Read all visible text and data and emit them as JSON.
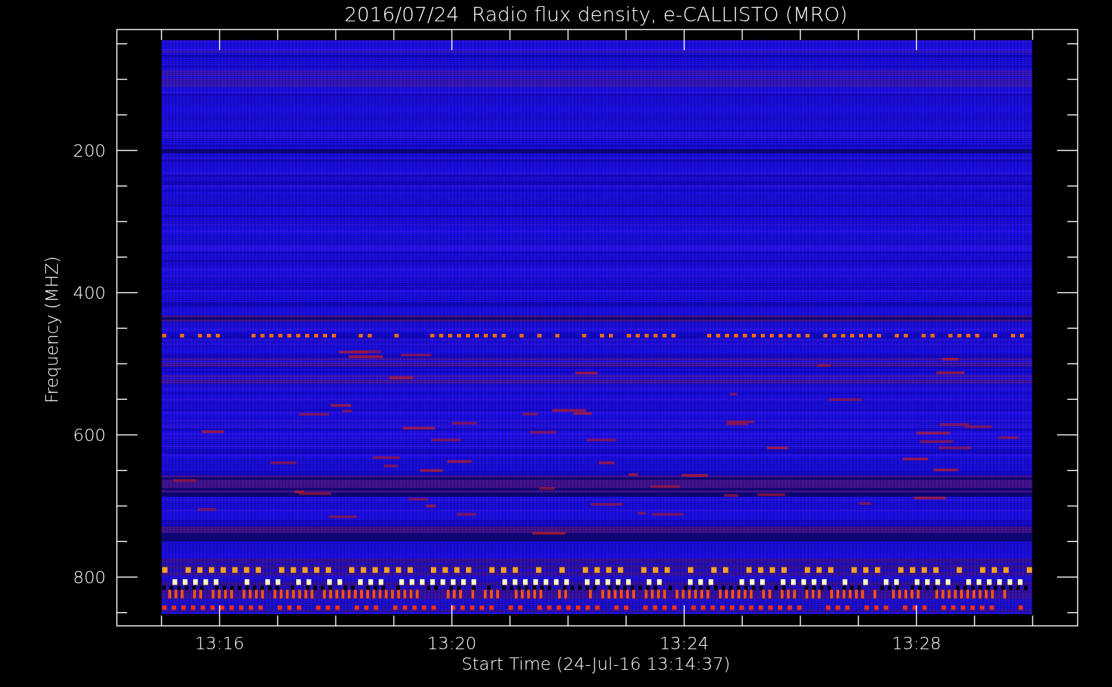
{
  "title": "2016/07/24  Radio flux density, e-CALLISTO (MRO)",
  "y_axis": {
    "label": "Frequency (MHZ)",
    "ticks": [
      "200",
      "400",
      "600",
      "800"
    ]
  },
  "x_axis": {
    "label": "Start Time (24-Jul-16 13:14:37)",
    "ticks": [
      "13:16",
      "13:20",
      "13:24",
      "13:28"
    ]
  }
}
